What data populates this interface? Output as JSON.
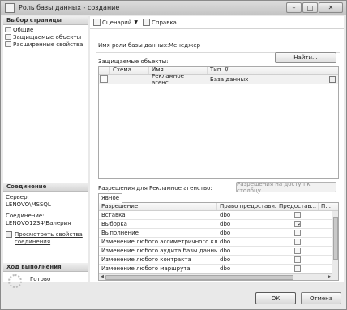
{
  "window": {
    "title": "Роль базы данных - создание"
  },
  "left": {
    "pages_header": "Выбор страницы",
    "pages": [
      {
        "label": "Общие"
      },
      {
        "label": "Защищаемые объекты"
      },
      {
        "label": "Расширенные свойства"
      }
    ],
    "connection_header": "Соединение",
    "server_label": "Сервер:",
    "server_value": "LENOVO\\MSSQL",
    "connection_label": "Соединение:",
    "connection_value": "LENOVO1234\\Валерия",
    "view_props_link": "Просмотреть свойства соединения",
    "progress_header": "Ход выполнения",
    "progress_status": "Готово"
  },
  "toolbar": {
    "script_label": "Сценарий",
    "help_label": "Справка"
  },
  "form": {
    "role_name_label": "Имя роли базы данных:",
    "role_name_value": "Менеджер",
    "securables_label": "Защищаемые объекты:",
    "find_button": "Найти...",
    "securables_columns": [
      "Схема",
      "Имя",
      "Тип"
    ],
    "securables_rows": [
      {
        "schema": "",
        "name": "Рекламное агенс...",
        "type": "База данных"
      }
    ],
    "permissions_label": "Разрешения для Рекламное агенство:",
    "column_permissions_button": "Разрешения на доступ к столбцу...",
    "tab_explicit": "Явное",
    "permissions_columns": [
      "Разрешение",
      "Право предоставил",
      "Предостав...",
      "П..."
    ],
    "permissions_rows": [
      {
        "permission": "Вставка",
        "grantor": "dbo",
        "grant": false
      },
      {
        "permission": "Выборка",
        "grantor": "dbo",
        "grant": true
      },
      {
        "permission": "Выполнение",
        "grantor": "dbo",
        "grant": false
      },
      {
        "permission": "Изменение любого ассиметричного ключа",
        "grantor": "dbo",
        "grant": false
      },
      {
        "permission": "Изменение любого аудита базы данных",
        "grantor": "dbo",
        "grant": false
      },
      {
        "permission": "Изменение любого контракта",
        "grantor": "dbo",
        "grant": false
      },
      {
        "permission": "Изменение любого маршрута",
        "grantor": "dbo",
        "grant": false
      }
    ]
  },
  "buttons": {
    "ok": "ОК",
    "cancel": "Отмена"
  },
  "colors": {
    "window_bg": "#e9e9e9",
    "panel_bg": "#ffffff",
    "selected_row_bg": "#f1f1f1"
  }
}
